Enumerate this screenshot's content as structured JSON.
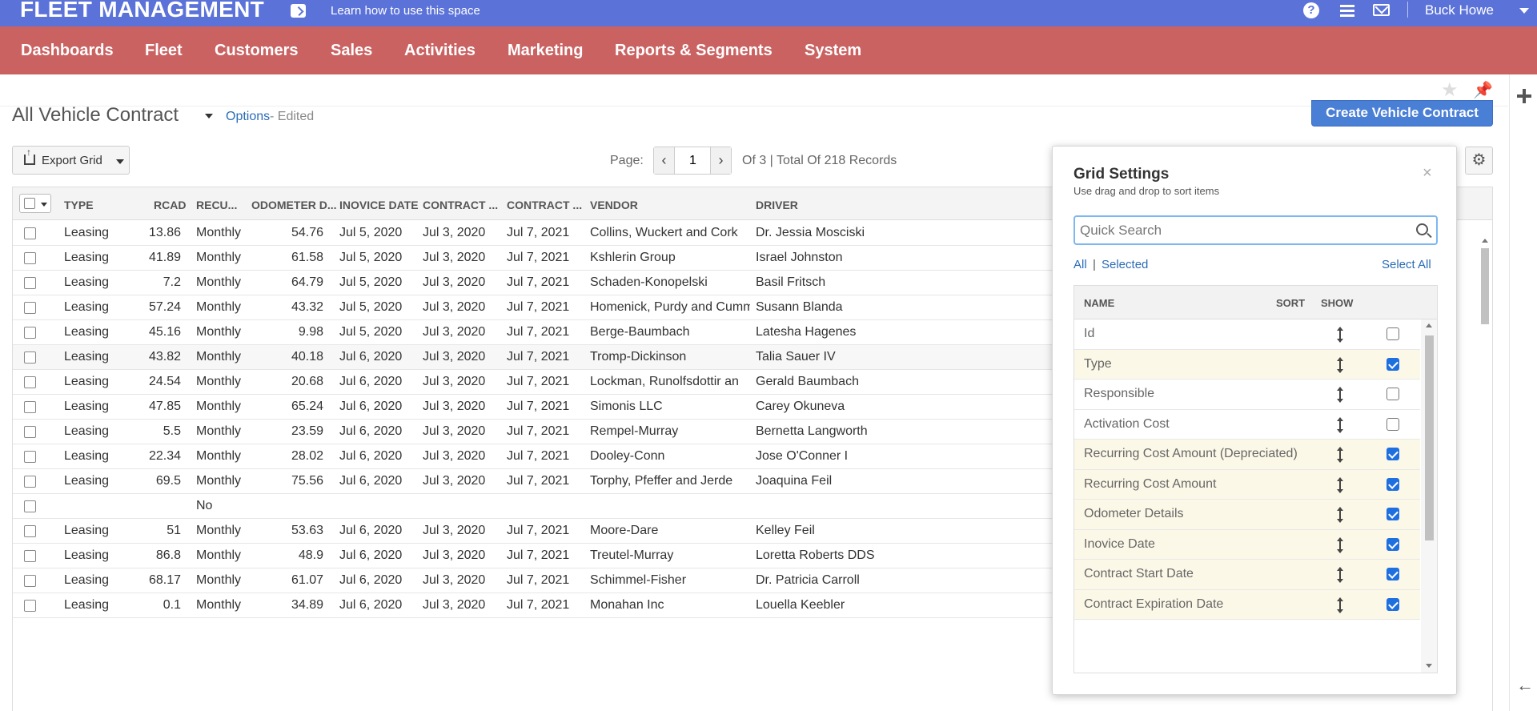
{
  "header": {
    "brand": "FLEET MANAGEMENT",
    "learn_link": "Learn how to use this space",
    "help_glyph": "?",
    "user_name": "Buck Howe"
  },
  "nav": [
    "Dashboards",
    "Fleet",
    "Customers",
    "Sales",
    "Activities",
    "Marketing",
    "Reports & Segments",
    "System"
  ],
  "page": {
    "title": "All Vehicle Contract",
    "options_link": "Options",
    "edited": "- Edited",
    "create_button": "Create Vehicle Contract"
  },
  "toolbar": {
    "export_label": "Export Grid",
    "page_label": "Page:",
    "current_page": "1",
    "prev_glyph": "‹",
    "next_glyph": "›",
    "records_text": "Of 3 | Total Of 218 Records",
    "settings_glyph": "⚙"
  },
  "grid": {
    "columns": [
      "TYPE",
      "RCAD",
      "RECU...",
      "ODOMETER D...",
      "INOVICE DATE",
      "CONTRACT ...",
      "CONTRACT ...",
      "VENDOR",
      "DRIVER"
    ],
    "rows": [
      [
        "Leasing",
        "13.86",
        "Monthly",
        "54.76",
        "Jul 5, 2020",
        "Jul 3, 2020",
        "Jul 7, 2021",
        "Collins, Wuckert and Cork",
        "Dr. Jessia Mosciski"
      ],
      [
        "Leasing",
        "41.89",
        "Monthly",
        "61.58",
        "Jul 5, 2020",
        "Jul 3, 2020",
        "Jul 7, 2021",
        "Kshlerin Group",
        "Israel Johnston"
      ],
      [
        "Leasing",
        "7.2",
        "Monthly",
        "64.79",
        "Jul 5, 2020",
        "Jul 3, 2020",
        "Jul 7, 2021",
        "Schaden-Konopelski",
        "Basil Fritsch"
      ],
      [
        "Leasing",
        "57.24",
        "Monthly",
        "43.32",
        "Jul 5, 2020",
        "Jul 3, 2020",
        "Jul 7, 2021",
        "Homenick, Purdy and Cumme",
        "Susann Blanda"
      ],
      [
        "Leasing",
        "45.16",
        "Monthly",
        "9.98",
        "Jul 5, 2020",
        "Jul 3, 2020",
        "Jul 7, 2021",
        "Berge-Baumbach",
        "Latesha Hagenes"
      ],
      [
        "Leasing",
        "43.82",
        "Monthly",
        "40.18",
        "Jul 6, 2020",
        "Jul 3, 2020",
        "Jul 7, 2021",
        "Tromp-Dickinson",
        "Talia Sauer IV"
      ],
      [
        "Leasing",
        "24.54",
        "Monthly",
        "20.68",
        "Jul 6, 2020",
        "Jul 3, 2020",
        "Jul 7, 2021",
        "Lockman, Runolfsdottir an",
        "Gerald Baumbach"
      ],
      [
        "Leasing",
        "47.85",
        "Monthly",
        "65.24",
        "Jul 6, 2020",
        "Jul 3, 2020",
        "Jul 7, 2021",
        "Simonis LLC",
        "Carey Okuneva"
      ],
      [
        "Leasing",
        "5.5",
        "Monthly",
        "23.59",
        "Jul 6, 2020",
        "Jul 3, 2020",
        "Jul 7, 2021",
        "Rempel-Murray",
        "Bernetta Langworth"
      ],
      [
        "Leasing",
        "22.34",
        "Monthly",
        "28.02",
        "Jul 6, 2020",
        "Jul 3, 2020",
        "Jul 7, 2021",
        "Dooley-Conn",
        "Jose O'Conner I"
      ],
      [
        "Leasing",
        "69.5",
        "Monthly",
        "75.56",
        "Jul 6, 2020",
        "Jul 3, 2020",
        "Jul 7, 2021",
        "Torphy, Pfeffer and Jerde",
        "Joaquina Feil"
      ],
      [
        "",
        "",
        "No",
        "",
        "",
        "",
        "",
        "",
        ""
      ],
      [
        "Leasing",
        "51",
        "Monthly",
        "53.63",
        "Jul 6, 2020",
        "Jul 3, 2020",
        "Jul 7, 2021",
        "Moore-Dare",
        "Kelley Feil"
      ],
      [
        "Leasing",
        "86.8",
        "Monthly",
        "48.9",
        "Jul 6, 2020",
        "Jul 3, 2020",
        "Jul 7, 2021",
        "Treutel-Murray",
        "Loretta Roberts DDS"
      ],
      [
        "Leasing",
        "68.17",
        "Monthly",
        "61.07",
        "Jul 6, 2020",
        "Jul 3, 2020",
        "Jul 7, 2021",
        "Schimmel-Fisher",
        "Dr. Patricia Carroll"
      ],
      [
        "Leasing",
        "0.1",
        "Monthly",
        "34.89",
        "Jul 6, 2020",
        "Jul 3, 2020",
        "Jul 7, 2021",
        "Monahan Inc",
        "Louella Keebler"
      ]
    ]
  },
  "grid_settings": {
    "title": "Grid Settings",
    "subtitle": "Use drag and drop to sort items",
    "close_glyph": "×",
    "search_placeholder": "Quick Search",
    "filter_all": "All",
    "filter_sep": "|",
    "filter_selected": "Selected",
    "select_all": "Select All",
    "col_name": "NAME",
    "col_sort": "SORT",
    "col_show": "SHOW",
    "items": [
      {
        "name": "Id",
        "show": false
      },
      {
        "name": "Type",
        "show": true
      },
      {
        "name": "Responsible",
        "show": false
      },
      {
        "name": "Activation Cost",
        "show": false
      },
      {
        "name": "Recurring Cost Amount (Depreciated)",
        "show": true
      },
      {
        "name": "Recurring Cost Amount",
        "show": true
      },
      {
        "name": "Odometer Details",
        "show": true
      },
      {
        "name": "Inovice Date",
        "show": true
      },
      {
        "name": "Contract Start Date",
        "show": true
      },
      {
        "name": "Contract Expiration Date",
        "show": true
      }
    ]
  }
}
